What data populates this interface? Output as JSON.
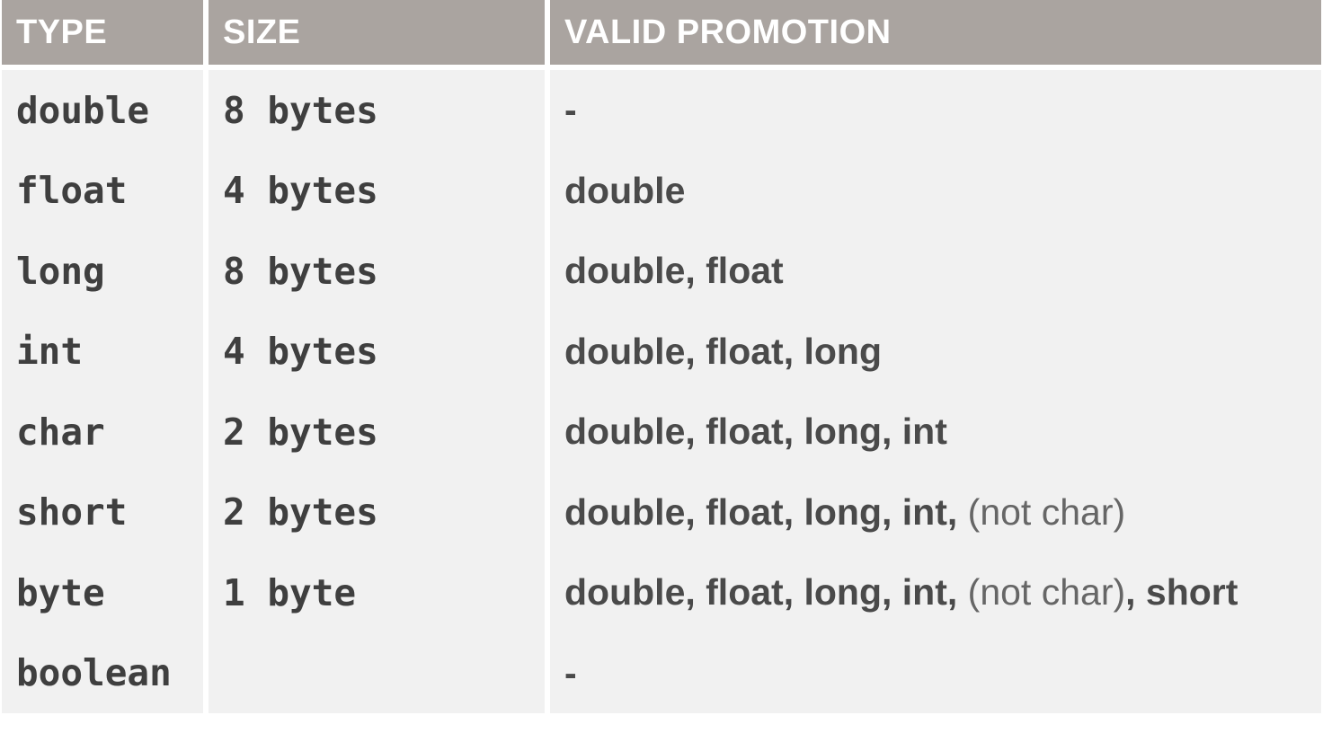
{
  "headers": {
    "type": "TYPE",
    "size": "SIZE",
    "promotion": "VALID PROMOTION"
  },
  "rows": [
    {
      "type": "double",
      "size": "8 bytes",
      "promo_bold": "-",
      "promo_light": "",
      "promo_tail": ""
    },
    {
      "type": "float",
      "size": "4 bytes",
      "promo_bold": "double",
      "promo_light": "",
      "promo_tail": ""
    },
    {
      "type": "long",
      "size": "8 bytes",
      "promo_bold": "double, float",
      "promo_light": "",
      "promo_tail": ""
    },
    {
      "type": "int",
      "size": "4 bytes",
      "promo_bold": "double, float, long",
      "promo_light": "",
      "promo_tail": ""
    },
    {
      "type": "char",
      "size": "2 bytes",
      "promo_bold": "double, float, long, int",
      "promo_light": "",
      "promo_tail": ""
    },
    {
      "type": "short",
      "size": "2 bytes",
      "promo_bold": "double, float, long, int, ",
      "promo_light": "(not char)",
      "promo_tail": ""
    },
    {
      "type": "byte",
      "size": "1 byte",
      "promo_bold": "double, float, long, int, ",
      "promo_light": "(not char)",
      "promo_tail": ", short"
    },
    {
      "type": "boolean",
      "size": "",
      "promo_bold": "-",
      "promo_light": "",
      "promo_tail": ""
    }
  ],
  "colors": {
    "header_bg": "#aaa4a0",
    "header_text": "#ffffff",
    "cell_bg": "#f1f1f1",
    "cell_text": "#3f3f3f"
  }
}
